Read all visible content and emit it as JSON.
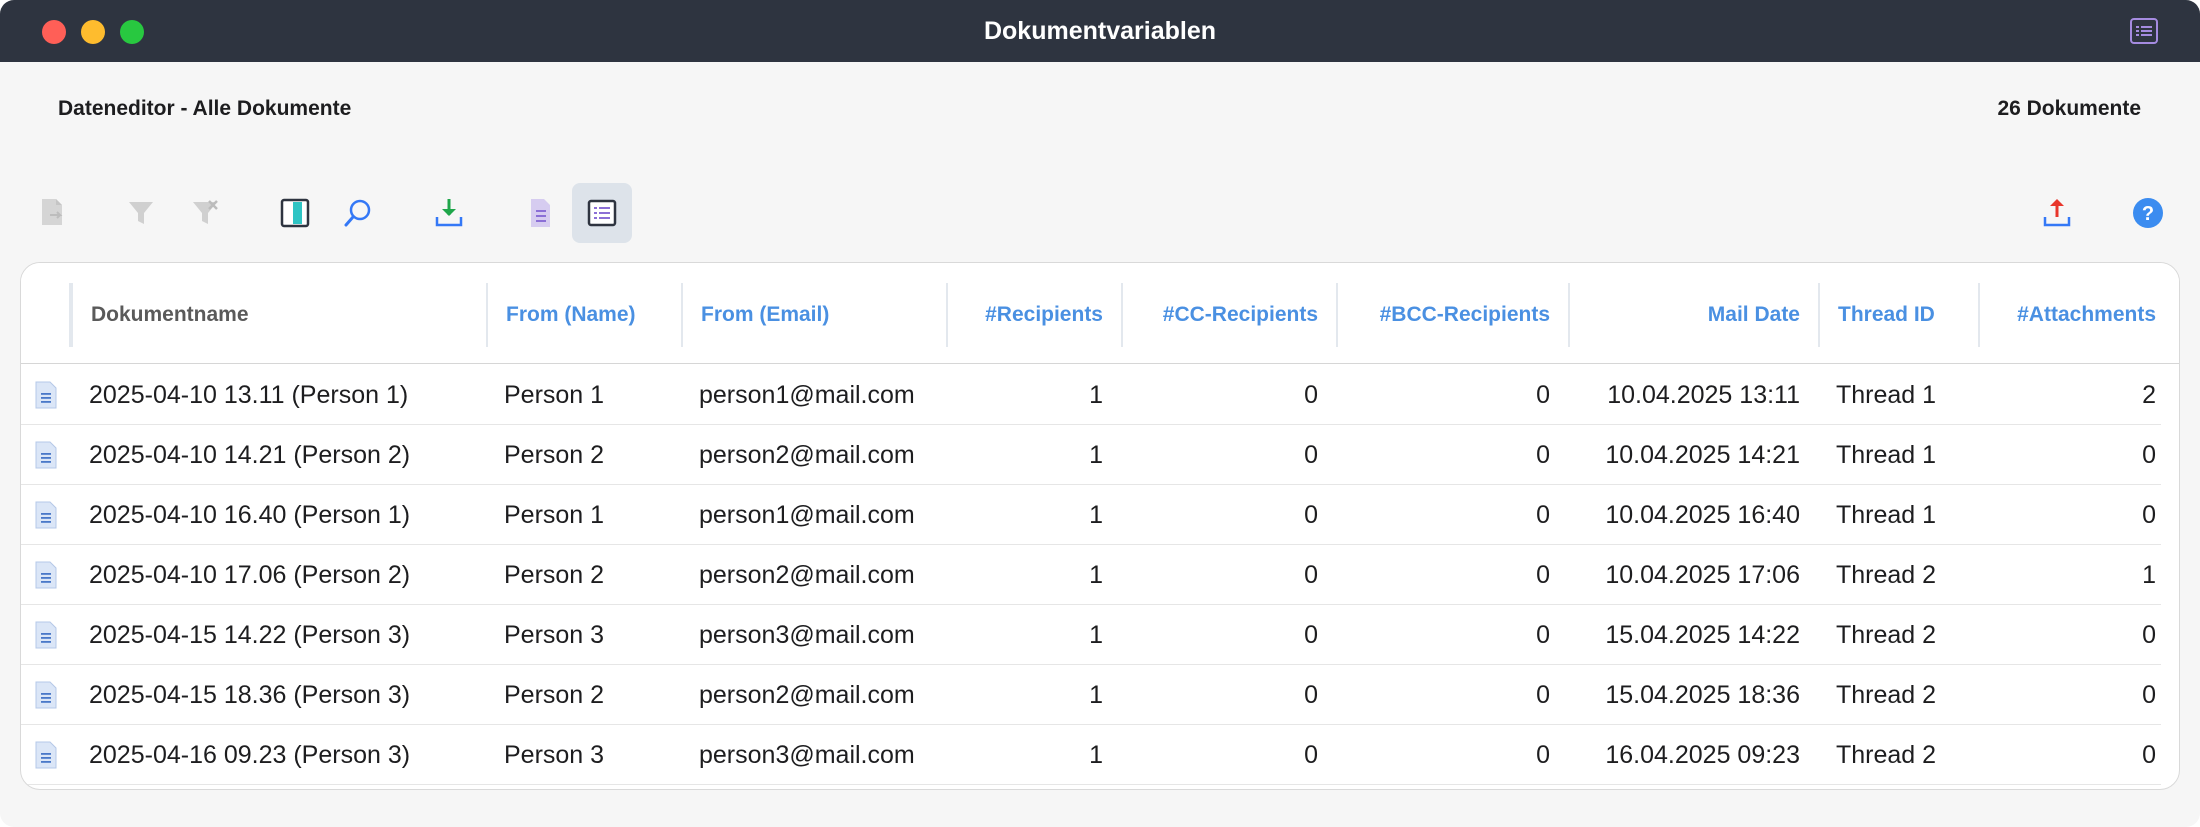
{
  "window": {
    "title": "Dokumentvariablen"
  },
  "header": {
    "left": "Dateneditor - Alle Dokumente",
    "right": "26 Dokumente"
  },
  "toolbar": [
    {
      "name": "new-document-icon",
      "state": "disabled"
    },
    {
      "name": "filter-icon",
      "state": "disabled"
    },
    {
      "name": "filter-clear-icon",
      "state": "disabled"
    },
    {
      "name": "columns-icon",
      "state": "enabled"
    },
    {
      "name": "search-icon",
      "state": "enabled"
    },
    {
      "name": "download-icon",
      "state": "enabled"
    },
    {
      "name": "document-list-icon",
      "state": "enabled"
    },
    {
      "name": "variable-list-icon",
      "state": "active"
    },
    {
      "name": "export-icon",
      "state": "enabled"
    },
    {
      "name": "help-icon",
      "state": "enabled"
    }
  ],
  "colors": {
    "titlebar": "#2e3440",
    "header_link": "#4a90e2",
    "row_icon": "#4a78c8"
  },
  "table": {
    "columns": [
      "Dokumentname",
      "From (Name)",
      "From (Email)",
      "#Recipients",
      "#CC-Recipients",
      "#BCC-Recipients",
      "Mail Date",
      "Thread ID",
      "#Attachments"
    ],
    "rows": [
      [
        "2025-04-10 13.11 (Person 1)",
        "Person 1",
        "person1@mail.com",
        "1",
        "0",
        "0",
        "10.04.2025 13:11",
        "Thread 1",
        "2"
      ],
      [
        "2025-04-10 14.21 (Person 2)",
        "Person 2",
        "person2@mail.com",
        "1",
        "0",
        "0",
        "10.04.2025 14:21",
        "Thread 1",
        "0"
      ],
      [
        "2025-04-10 16.40 (Person 1)",
        "Person 1",
        "person1@mail.com",
        "1",
        "0",
        "0",
        "10.04.2025 16:40",
        "Thread 1",
        "0"
      ],
      [
        "2025-04-10 17.06 (Person 2)",
        "Person 2",
        "person2@mail.com",
        "1",
        "0",
        "0",
        "10.04.2025 17:06",
        "Thread 2",
        "1"
      ],
      [
        "2025-04-15 14.22 (Person 3)",
        "Person 3",
        "person3@mail.com",
        "1",
        "0",
        "0",
        "15.04.2025 14:22",
        "Thread 2",
        "0"
      ],
      [
        "2025-04-15 18.36 (Person 3)",
        "Person 2",
        "person2@mail.com",
        "1",
        "0",
        "0",
        "15.04.2025 18:36",
        "Thread 2",
        "0"
      ],
      [
        "2025-04-16 09.23 (Person 3)",
        "Person 3",
        "person3@mail.com",
        "1",
        "0",
        "0",
        "16.04.2025 09:23",
        "Thread 2",
        "0"
      ]
    ]
  }
}
